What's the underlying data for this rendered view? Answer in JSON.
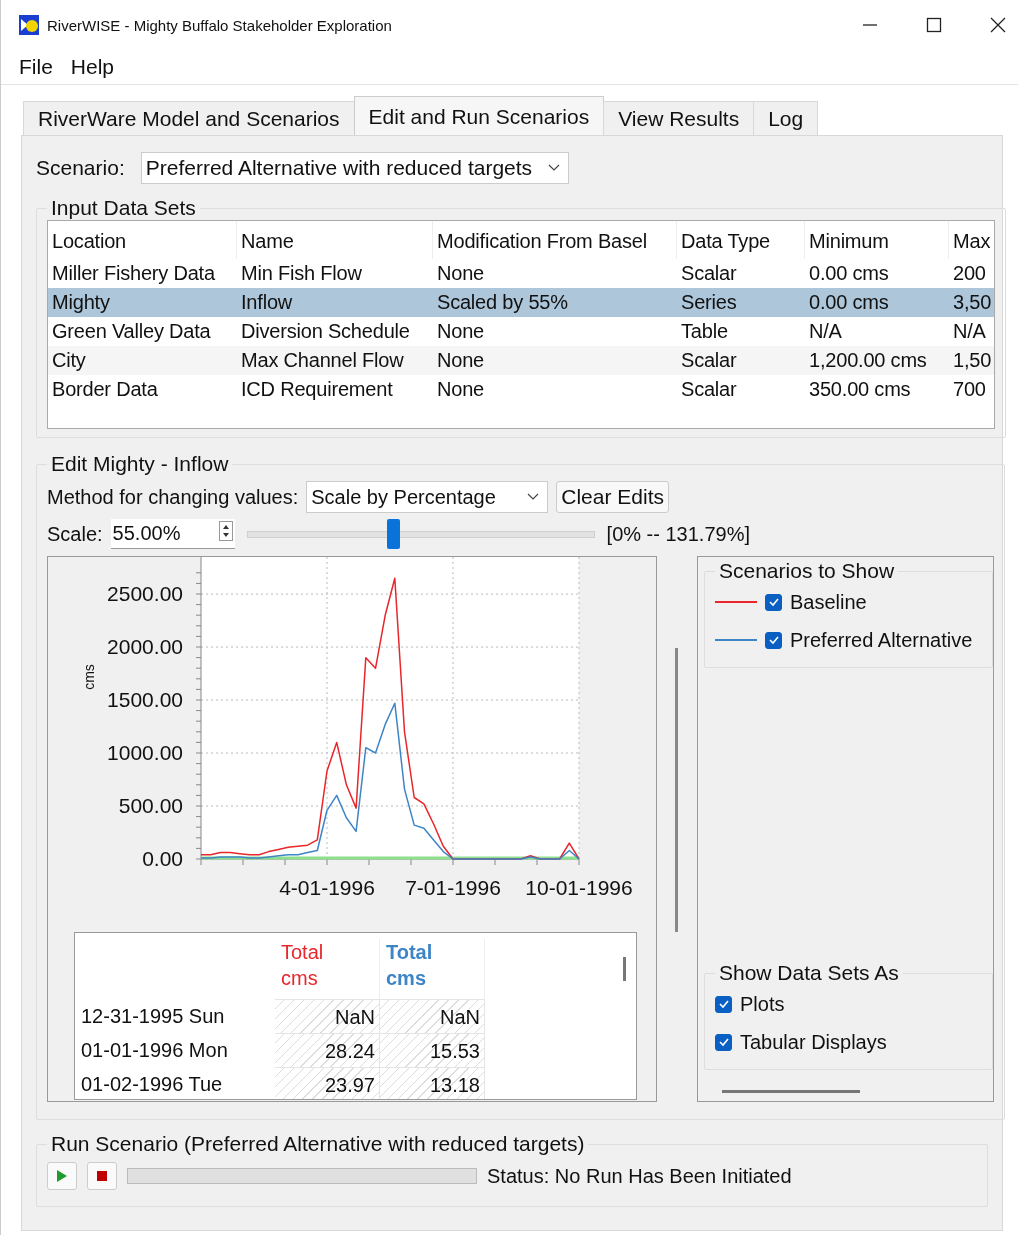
{
  "window": {
    "title": "RiverWISE - Mighty Buffalo Stakeholder Exploration"
  },
  "menu": [
    "File",
    "Help"
  ],
  "tabs": [
    {
      "label": "RiverWare Model and Scenarios",
      "selected": false
    },
    {
      "label": "Edit and Run Scenarios",
      "selected": true
    },
    {
      "label": "View Results",
      "selected": false
    },
    {
      "label": "Log",
      "selected": false
    }
  ],
  "scenario": {
    "label": "Scenario:",
    "value": "Preferred Alternative with reduced targets"
  },
  "input_data_sets": {
    "title": "Input Data Sets",
    "columns": [
      "Location",
      "Name",
      "Modification From Basel",
      "Data Type",
      "Minimum",
      "Max"
    ],
    "rows": [
      {
        "cells": [
          "Miller Fishery Data",
          "Min Fish Flow",
          "None",
          "Scalar",
          "0.00 cms",
          "200"
        ],
        "selected": false
      },
      {
        "cells": [
          "Mighty",
          "Inflow",
          "Scaled by 55%",
          "Series",
          "0.00 cms",
          "3,50"
        ],
        "selected": true
      },
      {
        "cells": [
          "Green Valley Data",
          "Diversion Schedule",
          "None",
          "Table",
          "N/A",
          "N/A"
        ],
        "selected": false
      },
      {
        "cells": [
          "City",
          "Max Channel Flow",
          "None",
          "Scalar",
          "1,200.00 cms",
          "1,50"
        ],
        "selected": false
      },
      {
        "cells": [
          "Border Data",
          "ICD Requirement",
          "None",
          "Scalar",
          "350.00 cms",
          "700"
        ],
        "selected": false
      }
    ]
  },
  "edit": {
    "title": "Edit Mighty - Inflow",
    "method_label": "Method for changing values:",
    "method_value": "Scale by Percentage",
    "clear_button": "Clear Edits",
    "scale_label": "Scale:",
    "scale_value": "55.00%",
    "level": 0.42,
    "range": "[0% -- 131.79%]",
    "chart_data": {
      "type": "line",
      "ylabel": "cms",
      "categories": [
        null,
        null,
        null,
        null,
        null,
        null,
        null,
        null,
        null,
        null,
        null,
        null,
        null,
        "4-01-1996",
        null,
        null,
        null,
        null,
        null,
        null,
        null,
        null,
        null,
        null,
        null,
        null,
        "7-01-1996",
        null,
        null,
        null,
        null,
        null,
        null,
        null,
        null,
        null,
        null,
        null,
        null,
        "10-01-1996"
      ],
      "series": [
        {
          "name": "Baseline",
          "color": "#e8262b",
          "values": [
            40,
            40,
            60,
            60,
            50,
            40,
            40,
            70,
            90,
            110,
            120,
            130,
            180,
            830,
            1100,
            700,
            480,
            1900,
            1800,
            2300,
            2650,
            1200,
            580,
            520,
            330,
            120,
            0,
            0,
            0,
            0,
            0,
            0,
            0,
            0,
            30,
            0,
            0,
            0,
            150,
            0
          ]
        },
        {
          "name": "Preferred Alternative",
          "color": "#3d85c6",
          "values": [
            10,
            10,
            20,
            20,
            20,
            10,
            10,
            20,
            30,
            40,
            40,
            60,
            80,
            460,
            600,
            390,
            260,
            1050,
            1000,
            1270,
            1470,
            660,
            320,
            290,
            180,
            70,
            0,
            0,
            0,
            0,
            0,
            0,
            0,
            0,
            20,
            0,
            0,
            0,
            80,
            0
          ]
        }
      ],
      "ylim": [
        0,
        2850
      ],
      "grid": true,
      "yticks": [
        {
          "value": 0,
          "label": "0.00"
        },
        {
          "value": 500,
          "label": "500.00"
        },
        {
          "value": 1000,
          "label": "1000.00"
        },
        {
          "value": 1500,
          "label": "1500.00"
        },
        {
          "value": 2000,
          "label": "2000.00"
        },
        {
          "value": 2500,
          "label": "2500.00"
        }
      ]
    },
    "table": {
      "columns": [
        {
          "title": "Total",
          "unit": "cms",
          "color": "#e8262b"
        },
        {
          "title": "Total",
          "unit": "cms",
          "color": "#3d85c6"
        }
      ],
      "rows": [
        {
          "date": "12-31-1995 Sun",
          "values": [
            "NaN",
            "NaN"
          ]
        },
        {
          "date": "01-01-1996 Mon",
          "values": [
            "28.24",
            "15.53"
          ]
        },
        {
          "date": "01-02-1996 Tue",
          "values": [
            "23.97",
            "13.18"
          ]
        }
      ]
    },
    "scenarios_to_show": {
      "title": "Scenarios to Show",
      "items": [
        {
          "checked": true
        },
        {
          "checked": true
        }
      ]
    },
    "show_as": {
      "title": "Show Data Sets As",
      "items": [
        {
          "label": "Plots",
          "checked": true
        },
        {
          "label": "Tabular Displays",
          "checked": true
        }
      ]
    }
  },
  "run": {
    "title": "Run Scenario (Preferred Alternative with reduced targets)",
    "level": 0,
    "status": "Status: No Run Has Been Initiated"
  }
}
